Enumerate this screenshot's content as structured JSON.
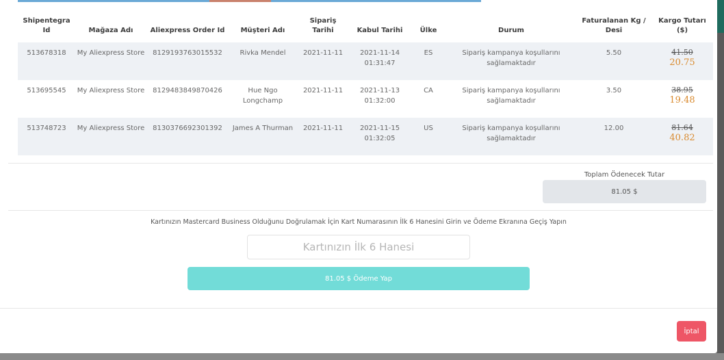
{
  "table": {
    "headers": {
      "shipentegra_id": "Shipentegra Id",
      "store_name": "Mağaza Adı",
      "order_id": "Aliexpress Order Id",
      "customer": "Müşteri Adı",
      "order_date": "Sipariş Tarihi",
      "accept_date": "Kabul Tarihi",
      "country": "Ülke",
      "status": "Durum",
      "billed_kg": "Faturalanan Kg / Desi",
      "shipping_amount": "Kargo Tutarı ($)"
    },
    "rows": [
      {
        "id": "513678318",
        "store": "My Aliexpress Store",
        "order_id": "8129193763015532",
        "customer": "Rivka Mendel",
        "order_date": "2021-11-11",
        "accept_date": "2021-11-14",
        "accept_time": "01:31:47",
        "country": "ES",
        "status": "Sipariş kampanya koşullarını sağlamaktadır",
        "kg": "5.50",
        "old_price": "41.50",
        "new_price": "20.75"
      },
      {
        "id": "513695545",
        "store": "My Aliexpress Store",
        "order_id": "8129483849870426",
        "customer": "Hue Ngo Longchamp",
        "order_date": "2021-11-11",
        "accept_date": "2021-11-13",
        "accept_time": "01:32:00",
        "country": "CA",
        "status": "Sipariş kampanya koşullarını sağlamaktadır",
        "kg": "3.50",
        "old_price": "38.95",
        "new_price": "19.48"
      },
      {
        "id": "513748723",
        "store": "My Aliexpress Store",
        "order_id": "8130376692301392",
        "customer": "James A Thurman",
        "order_date": "2021-11-11",
        "accept_date": "2021-11-15",
        "accept_time": "01:32:05",
        "country": "US",
        "status": "Sipariş kampanya koşullarını sağlamaktadır",
        "kg": "12.00",
        "old_price": "81.64",
        "new_price": "40.82"
      }
    ]
  },
  "summary": {
    "total_label": "Toplam Ödenecek Tutar",
    "total_value": "81.05 $"
  },
  "payment": {
    "instruction": "Kartınızın Mastercard Business Olduğunu Doğrulamak İçin Kart Numarasının İlk 6 Hanesini Girin ve Ödeme Ekranına Geçiş Yapın",
    "card_placeholder": "Kartınızın İlk 6 Hanesi",
    "card_value": "",
    "pay_button": "81.05 $ Ödeme Yap"
  },
  "footer": {
    "cancel_button": "İptal"
  },
  "colors": {
    "accent": "#3bbcc0",
    "pay_button": "#72dcd8",
    "discount_price": "#d98a2e",
    "cancel_button": "#ee5666"
  }
}
